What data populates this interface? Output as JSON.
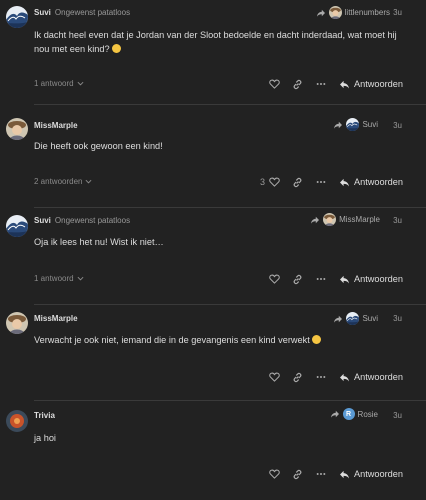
{
  "posts": [
    {
      "username": "Suvi",
      "user_title": "Ongewenst patatloos",
      "reply_to": "littlenumbers",
      "time": "3u",
      "body": "Ik dacht heel even dat je Jordan van der Sloot bedoelde en dacht inderdaad, wat moet hij nou met een kind?",
      "emoji": "thinking-face",
      "replies": "1 antwoord",
      "likes": "",
      "reply_label": "Antwoorden"
    },
    {
      "username": "MissMarple",
      "user_title": "",
      "reply_to": "Suvi",
      "time": "3u",
      "body": "Die heeft ook gewoon een kind!",
      "replies": "2 antwoorden",
      "likes": "3",
      "reply_label": "Antwoorden"
    },
    {
      "username": "Suvi",
      "user_title": "Ongewenst patatloos",
      "reply_to": "MissMarple",
      "time": "3u",
      "body": "Oja ik lees het nu! Wist ik niet…",
      "replies": "1 antwoord",
      "likes": "",
      "reply_label": "Antwoorden"
    },
    {
      "username": "MissMarple",
      "user_title": "",
      "reply_to": "Suvi",
      "time": "3u",
      "body": "Verwacht je ook niet, iemand die in de gevangenis een kind verwekt",
      "emoji": "grinning-squinting-face",
      "replies": "",
      "likes": "",
      "reply_label": "Antwoorden"
    },
    {
      "username": "Trivia",
      "user_title": "",
      "reply_to": "Rosie",
      "reply_to_letter": "R",
      "time": "3u",
      "body": "ja hoi",
      "replies": "",
      "likes": "",
      "reply_label": "Antwoorden"
    }
  ],
  "icons": {
    "like": "heart-icon",
    "link": "link-icon",
    "more": "ellipsis-icon",
    "reply": "reply-arrow-icon",
    "reply_to": "share-arrow-icon",
    "expand": "chevron-down-icon"
  },
  "colors": {
    "background": "#222222",
    "text": "#dddddd",
    "muted": "#999999",
    "letter_avatar": "#5b9bd5"
  }
}
